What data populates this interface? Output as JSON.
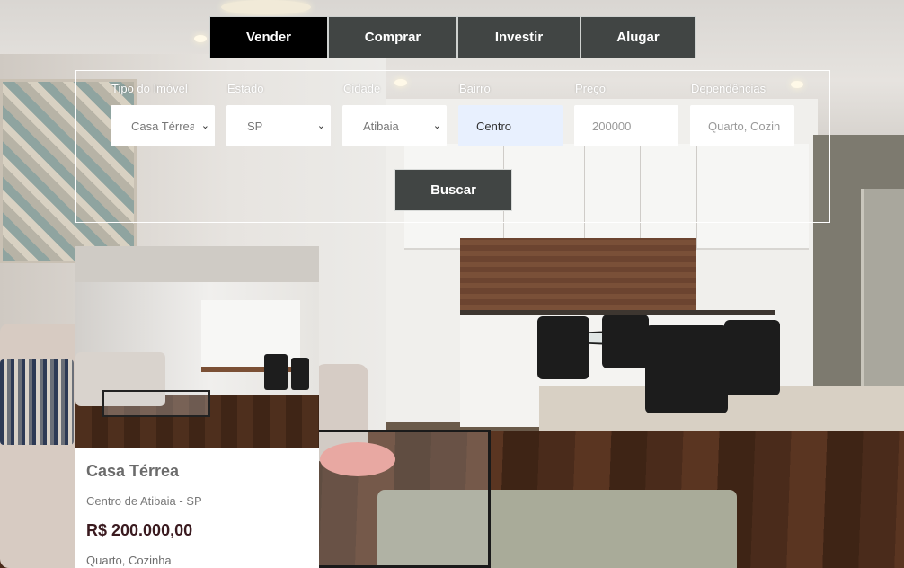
{
  "tabs": [
    {
      "label": "Vender",
      "active": true
    },
    {
      "label": "Comprar",
      "active": false
    },
    {
      "label": "Investir",
      "active": false
    },
    {
      "label": "Alugar",
      "active": false
    }
  ],
  "filters": {
    "tipo": {
      "label": "Tipo do Imóvel",
      "value": "Casa Térrea"
    },
    "estado": {
      "label": "Estado",
      "value": "SP"
    },
    "cidade": {
      "label": "Cidade",
      "value": "Atibaia"
    },
    "bairro": {
      "label": "Bairro",
      "value": "Centro"
    },
    "preco": {
      "label": "Preço",
      "placeholder": "200000"
    },
    "dependencias": {
      "label": "Dependências",
      "placeholder": "Quarto, Cozinha"
    }
  },
  "search_button": "Buscar",
  "card": {
    "title": "Casa Térrea",
    "location": "Centro de Atibaia - SP",
    "price": "R$ 200.000,00",
    "rooms": "Quarto, Cozinha"
  },
  "colors": {
    "tab_active": "#000000",
    "tab_default": "#414544",
    "autofill": "#e8f0fe",
    "price": "#3a1a1f"
  }
}
